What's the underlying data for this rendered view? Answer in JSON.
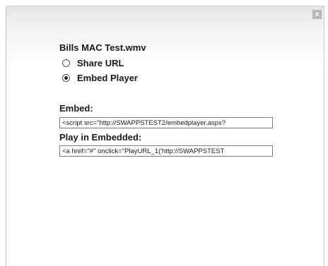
{
  "dialog": {
    "close_label": "x",
    "title": "Bills MAC Test.wmv",
    "options": [
      {
        "label": "Share URL",
        "checked": false
      },
      {
        "label": "Embed Player",
        "checked": true
      }
    ],
    "embed_label": "Embed:",
    "embed_value": "<script src=\"http://SWAPPSTEST2/embedplayer.aspx?",
    "play_label": "Play in Embedded:",
    "play_value": "<a href=\"#\" onclick=\"PlayURL_1('http://SWAPPSTEST"
  }
}
